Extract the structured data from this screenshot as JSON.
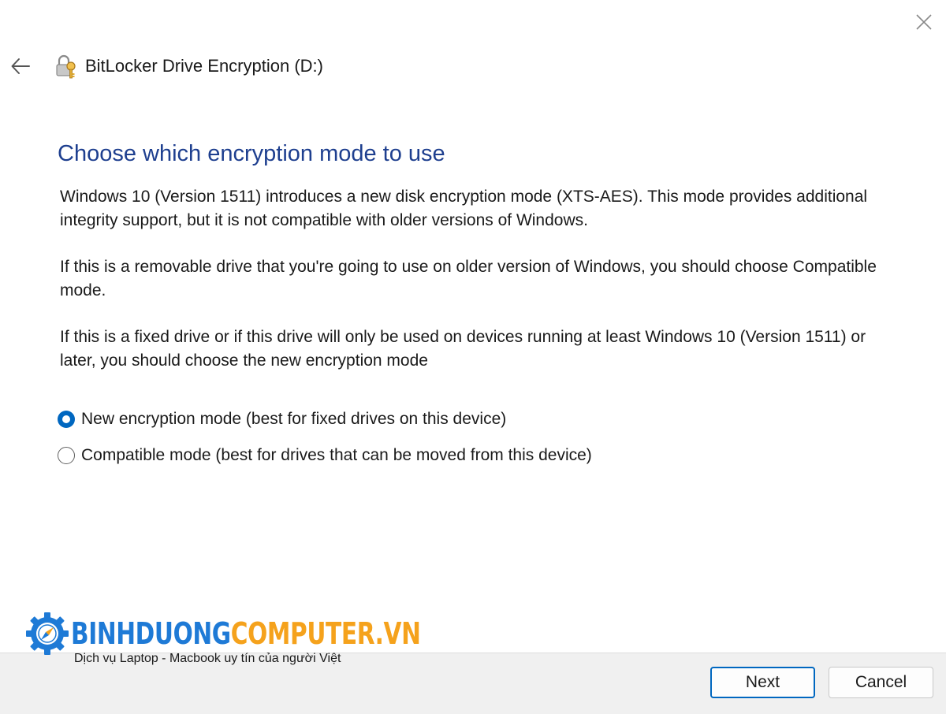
{
  "window": {
    "title": "BitLocker Drive Encryption (D:)",
    "close_icon": "close-icon",
    "back_icon": "back-arrow-icon",
    "app_icon": "bitlocker-key-icon"
  },
  "page": {
    "title": "Choose which encryption mode to use",
    "paragraphs": [
      "Windows 10 (Version 1511) introduces a new disk encryption mode (XTS-AES). This mode provides additional integrity support, but it is not compatible with older versions of Windows.",
      "If this is a removable drive that you're going to use on older version of Windows, you should choose Compatible mode.",
      "If this is a fixed drive or if this drive will only be used on devices running at least Windows 10 (Version 1511) or later, you should choose the new encryption mode"
    ],
    "options": [
      {
        "label": "New encryption mode (best for fixed drives on this device)",
        "selected": true
      },
      {
        "label": "Compatible mode (best for drives that can be moved from this device)",
        "selected": false
      }
    ]
  },
  "footer": {
    "next_label": "Next",
    "cancel_label": "Cancel"
  },
  "watermark": {
    "brand_part1": "BINHDUONG",
    "brand_part2": "COMPUTER.VN",
    "slogan": "Dịch vụ Laptop - Macbook uy tín của người Việt",
    "colors": {
      "blue": "#1e7ad6",
      "orange": "#f5a21c"
    }
  },
  "colors": {
    "title_blue": "#1e3f8f",
    "accent": "#0067c0",
    "footer_bg": "#f0f0f0"
  }
}
